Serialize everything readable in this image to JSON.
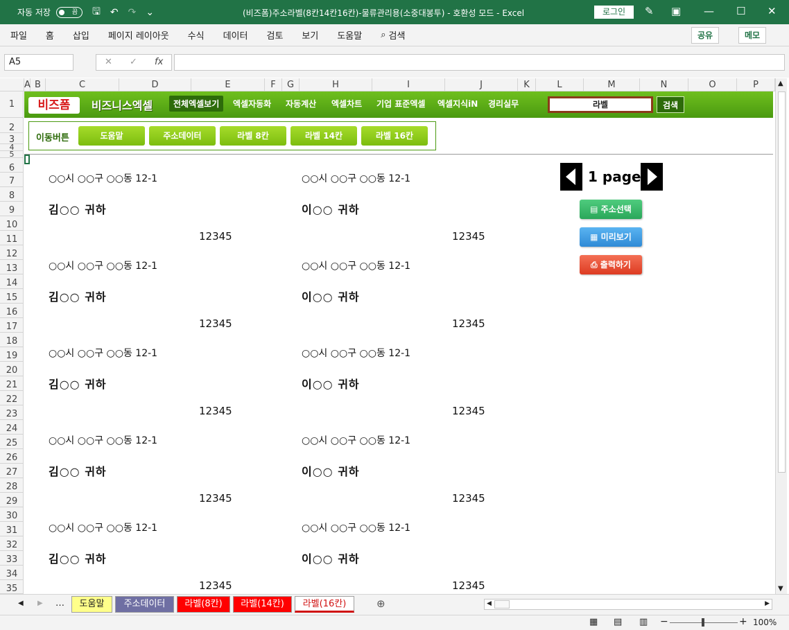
{
  "titlebar": {
    "autosave_label": "자동 저장",
    "autosave_state": "끔",
    "title": "(비즈폼)주소라벨(8칸14칸16칸)-물류관리용(소중대봉투)  -  호환성 모드  -  Excel",
    "login_label": "로그인"
  },
  "ribbon": {
    "tabs": [
      "파일",
      "홈",
      "삽입",
      "페이지 레이아웃",
      "수식",
      "데이터",
      "검토",
      "보기",
      "도움말"
    ],
    "search_label": "검색",
    "share_label": "공유",
    "memo_label": "메모"
  },
  "formula": {
    "namebox": "A5",
    "fx": "fx",
    "value": ""
  },
  "columns": [
    "A",
    "B",
    "C",
    "D",
    "E",
    "F",
    "G",
    "H",
    "I",
    "J",
    "K",
    "L",
    "M",
    "N",
    "O",
    "P"
  ],
  "rows": [
    "1",
    "2",
    "3",
    "4",
    "5",
    "6",
    "7",
    "8",
    "9",
    "10",
    "11",
    "12",
    "13",
    "14",
    "15",
    "16",
    "17",
    "18",
    "19",
    "20",
    "21",
    "22",
    "23",
    "24",
    "25",
    "26",
    "27",
    "28",
    "29",
    "30",
    "31",
    "32",
    "33",
    "34",
    "35"
  ],
  "banner": {
    "logo1": "비즈폼",
    "logo2": "비즈니스엑셀",
    "nav": [
      "전체엑셀보기",
      "엑셀자동화",
      "자동계산",
      "엑셀차트",
      "기업 표준엑셀",
      "엑셀지식iN",
      "경리실무"
    ],
    "search_value": "라벨",
    "search_button": "검색"
  },
  "move": {
    "label": "이동버튼",
    "buttons": [
      "도움말",
      "주소데이터",
      "라벨 8칸",
      "라벨 14칸",
      "라벨 16칸"
    ]
  },
  "labels": {
    "address": "○○시 ○○구 ○○동 12-1",
    "name_left": "김○○  귀하",
    "name_right": "이○○  귀하",
    "zip": "12345"
  },
  "pager": {
    "page_text": "1 page"
  },
  "actions": {
    "select_address": "주소선택",
    "preview": "미리보기",
    "print": "출력하기"
  },
  "sheet_tabs": [
    "도움말",
    "주소데이터",
    "라벨(8칸)",
    "라벨(14칸)",
    "라벨(16칸)"
  ],
  "status": {
    "zoom": "100%"
  }
}
